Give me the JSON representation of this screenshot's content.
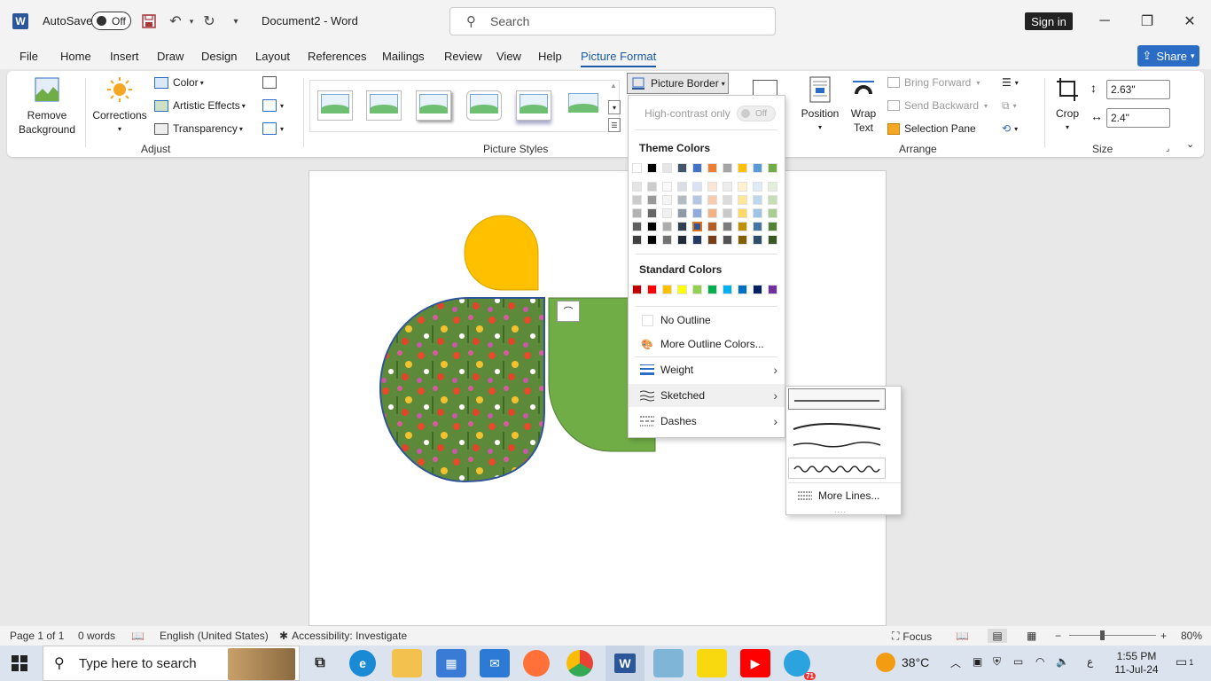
{
  "titlebar": {
    "autosave_label": "AutoSave",
    "autosave_state": "Off",
    "doc_title": "Document2  -  Word",
    "search_placeholder": "Search",
    "signin_label": "Sign in"
  },
  "tabs": [
    "File",
    "Home",
    "Insert",
    "Draw",
    "Design",
    "Layout",
    "References",
    "Mailings",
    "Review",
    "View",
    "Help",
    "Picture Format"
  ],
  "share_label": "Share",
  "ribbon": {
    "remove_background": "Remove Background",
    "corrections": "Corrections",
    "color": "Color",
    "artistic_effects": "Artistic Effects",
    "transparency": "Transparency",
    "adjust_label": "Adjust",
    "picture_styles_label": "Picture Styles",
    "picture_border": "Picture Border",
    "position": "Position",
    "wrap_text": "Wrap Text",
    "bring_forward": "Bring Forward",
    "send_backward": "Send Backward",
    "selection_pane": "Selection Pane",
    "arrange_label": "Arrange",
    "crop": "Crop",
    "height": "2.63\"",
    "width": "2.4\"",
    "size_label": "Size"
  },
  "border_menu": {
    "high_contrast": "High-contrast only",
    "high_contrast_state": "Off",
    "theme_colors": "Theme Colors",
    "standard_colors": "Standard Colors",
    "no_outline": "No Outline",
    "more_colors": "More Outline Colors...",
    "weight": "Weight",
    "sketched": "Sketched",
    "dashes": "Dashes",
    "theme_top_row": [
      "#ffffff",
      "#000000",
      "#e7e6e6",
      "#44546a",
      "#4472c4",
      "#ed7d31",
      "#a5a5a5",
      "#ffc000",
      "#5b9bd5",
      "#70ad47"
    ],
    "standard_row": [
      "#c00000",
      "#ff0000",
      "#ffc000",
      "#ffff00",
      "#92d050",
      "#00b050",
      "#00b0f0",
      "#0070c0",
      "#002060",
      "#7030a0"
    ]
  },
  "sketched_menu": {
    "more_lines": "More Lines..."
  },
  "statusbar": {
    "page": "Page 1 of 1",
    "words": "0 words",
    "language": "English (United States)",
    "accessibility": "Accessibility: Investigate",
    "focus": "Focus",
    "zoom": "80%"
  },
  "taskbar": {
    "search_placeholder": "Type here to search",
    "temperature": "38°C",
    "time": "1:55 PM",
    "date": "11-Jul-24",
    "notification_count": "1",
    "telegram_badge": "71",
    "ime": "ع"
  }
}
